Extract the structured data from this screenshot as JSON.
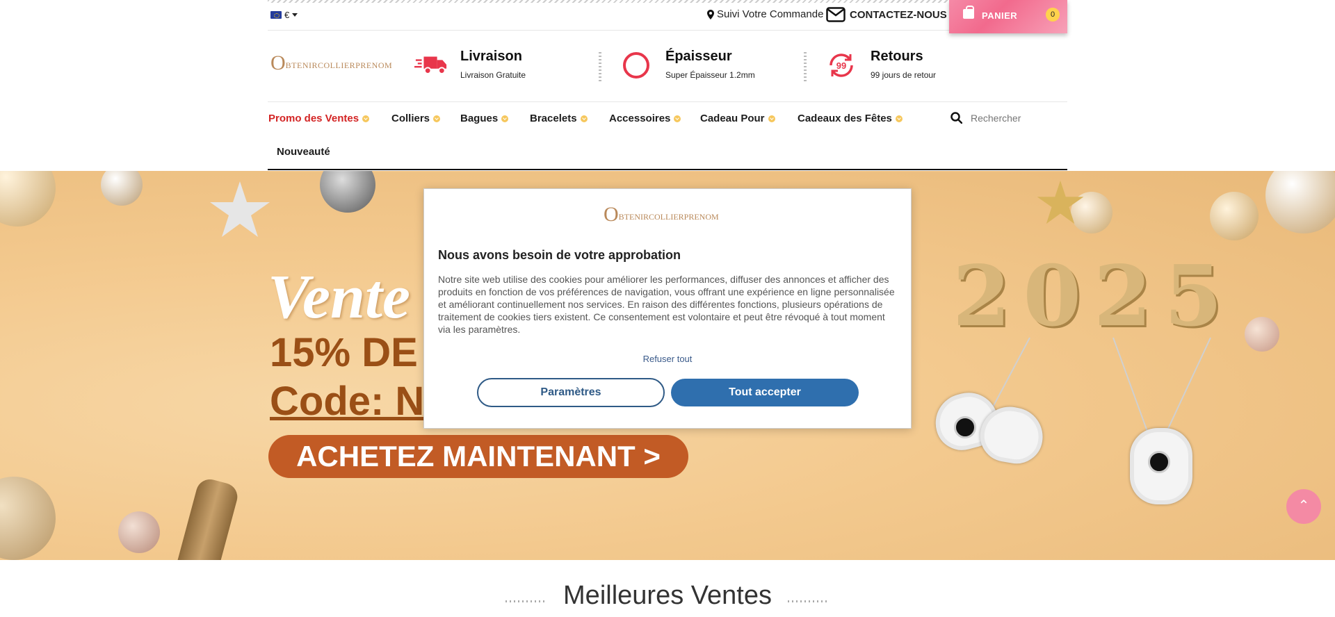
{
  "topbar": {
    "currency": "€",
    "track_order": "Suivi Votre Commande",
    "contact": "CONTACTEZ-NOUS",
    "cart_label": "PANIER",
    "cart_count": "0"
  },
  "brand": {
    "logo_initial": "O",
    "logo_text": "BTENIRCOLLIERPRENOM"
  },
  "features": [
    {
      "title": "Livraison",
      "subtitle": "Livraison Gratuite",
      "icon": "delivery-truck-icon"
    },
    {
      "title": "Épaisseur",
      "subtitle": "Super Épaisseur 1.2mm",
      "icon": "ring-circle-icon"
    },
    {
      "title": "Retours",
      "subtitle": "99 jours de retour",
      "icon": "return-99-icon",
      "badge": "99"
    }
  ],
  "nav": {
    "items": [
      {
        "label": "Promo des Ventes"
      },
      {
        "label": "Colliers"
      },
      {
        "label": "Bagues"
      },
      {
        "label": "Bracelets"
      },
      {
        "label": "Accessoires"
      },
      {
        "label": "Cadeau Pour"
      },
      {
        "label": "Cadeaux des Fêtes"
      },
      {
        "label": "Nouveauté"
      }
    ],
    "search_placeholder": "Rechercher"
  },
  "hero": {
    "script": "Vente",
    "line1": "15% DE",
    "line2": "Code: N",
    "button": "ACHETEZ MAINTENANT >",
    "year": "2025"
  },
  "cookie": {
    "title": "Nous avons besoin de votre approbation",
    "text": "Notre site web utilise des cookies pour améliorer les performances, diffuser des annonces et afficher des produits en fonction de vos préférences de navigation, vous offrant une expérience en ligne personnalisée et améliorant continuellement nos services. En raison des différentes fonctions, plusieurs opérations de traitement de cookies tiers existent. Ce consentement est volontaire et peut être révoqué à tout moment via les paramètres.",
    "refuse": "Refuser tout",
    "params": "Paramètres",
    "accept": "Tout accepter"
  },
  "section": {
    "best_sellers": "Meilleures Ventes"
  },
  "colors": {
    "accent": "#f26a8d",
    "promo": "#d32424",
    "button_blue": "#2f6fae",
    "gold": "#b9895a"
  }
}
